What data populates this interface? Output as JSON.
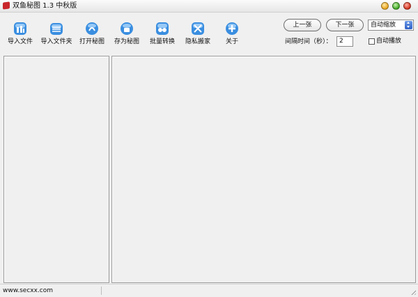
{
  "window": {
    "title": "双鱼秘图 1.3 中秋版"
  },
  "toolbar": {
    "items": [
      {
        "label": "导入文件",
        "icon": "import-file-icon"
      },
      {
        "label": "导入文件夹",
        "icon": "import-folder-icon"
      },
      {
        "label": "打开秘图",
        "icon": "open-secret-image-icon"
      },
      {
        "label": "存为秘图",
        "icon": "save-secret-image-icon"
      },
      {
        "label": "批量转换",
        "icon": "batch-convert-icon"
      },
      {
        "label": "隐私搬家",
        "icon": "privacy-move-icon"
      },
      {
        "label": "关于",
        "icon": "about-icon"
      }
    ]
  },
  "controls": {
    "prev_label": "上一张",
    "next_label": "下一张",
    "zoom_mode": "自动缩放",
    "interval_label": "间隔时间（秒）：",
    "interval_value": "2",
    "autoplay_label": "自动播放",
    "autoplay_checked": false
  },
  "status": {
    "text": "www.secxx.com"
  },
  "colors": {
    "icon_blue": "#3a8ee0",
    "icon_light": "#bfe3ff",
    "close_red": "#d0301c",
    "minimize_amber": "#e8a318",
    "maximize_green": "#39a51f"
  }
}
